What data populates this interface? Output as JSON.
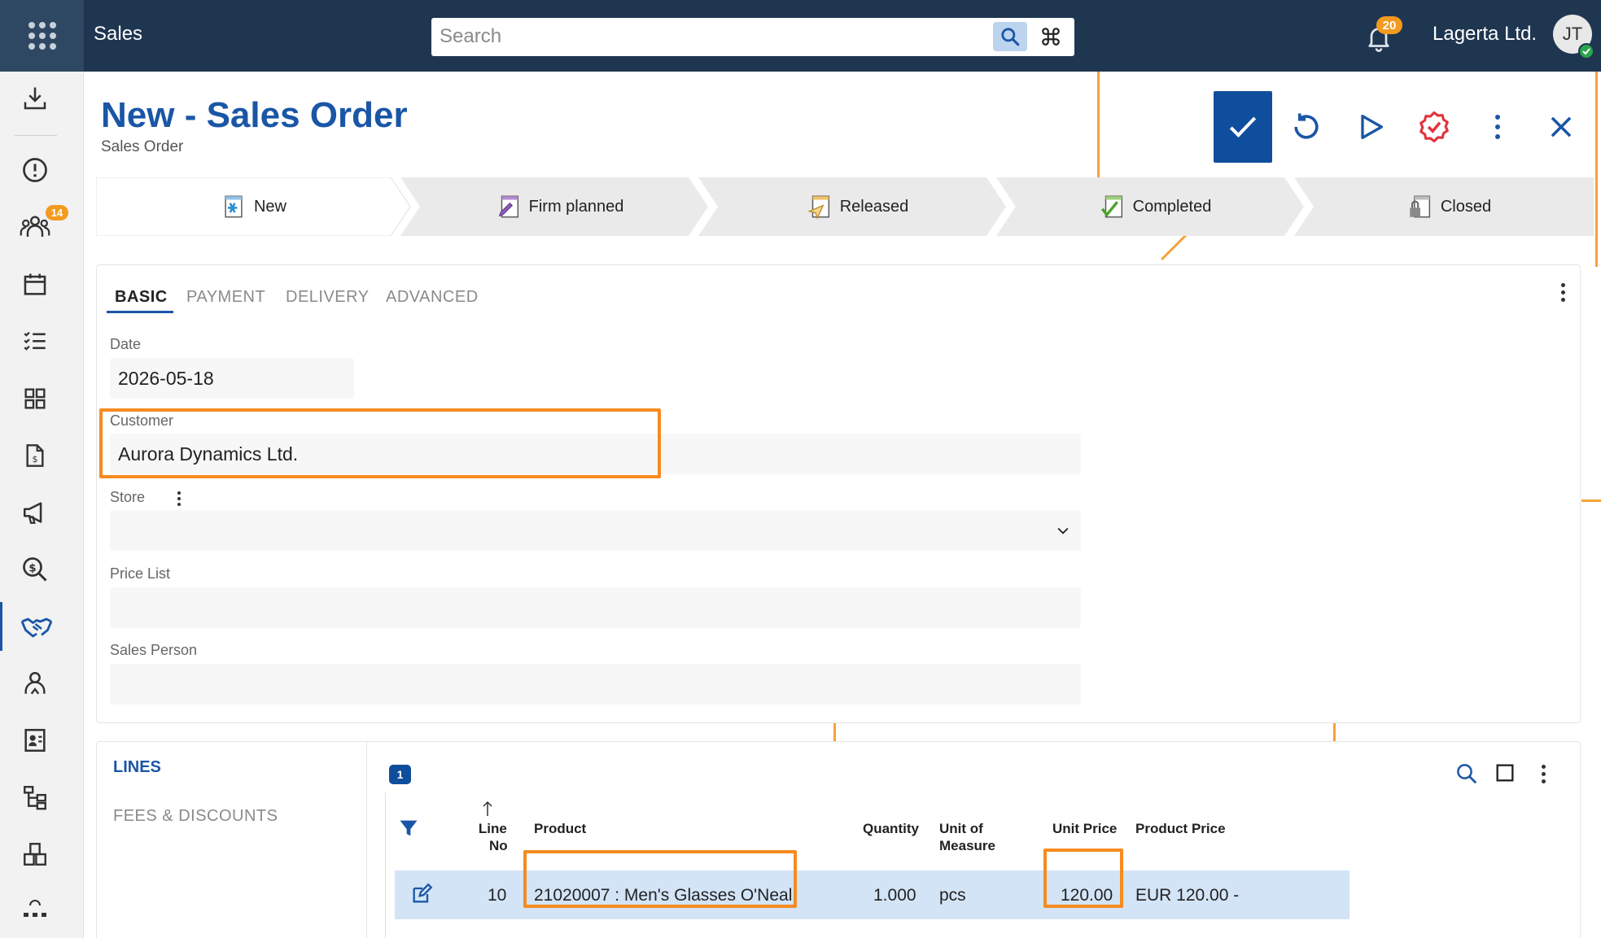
{
  "topbar": {
    "app_title": "Sales",
    "search_placeholder": "Search",
    "notification_count": "20",
    "company": "Lagerta Ltd.",
    "user_initials": "JT"
  },
  "sidebar": {
    "items": [
      {
        "icon": "download-tray-icon"
      },
      {
        "icon": "alert-circle-icon"
      },
      {
        "icon": "people-group-icon",
        "badge": "14"
      },
      {
        "icon": "calendar-icon"
      },
      {
        "icon": "checklist-icon"
      },
      {
        "icon": "dashboard-grid-icon"
      },
      {
        "icon": "document-icon"
      },
      {
        "icon": "megaphone-icon"
      },
      {
        "icon": "dollar-search-icon"
      },
      {
        "icon": "handshake-icon",
        "active": true
      },
      {
        "icon": "user-icon"
      },
      {
        "icon": "contact-card-icon"
      },
      {
        "icon": "hierarchy-icon"
      },
      {
        "icon": "boxes-icon"
      }
    ]
  },
  "page": {
    "title": "New - Sales Order",
    "subtitle": "Sales Order"
  },
  "status_steps": [
    "New",
    "Firm planned",
    "Released",
    "Completed",
    "Closed"
  ],
  "form": {
    "tabs": [
      "BASIC",
      "PAYMENT",
      "DELIVERY",
      "ADVANCED"
    ],
    "date_label": "Date",
    "date_value": "2026-05-18",
    "customer_label": "Customer",
    "customer_value": "Aurora Dynamics Ltd.",
    "store_label": "Store",
    "price_list_label": "Price List",
    "sales_person_label": "Sales Person"
  },
  "lines": {
    "nav_title": "LINES",
    "nav_sub": "FEES & DISCOUNTS",
    "count": "1",
    "columns": {
      "line_no_1": "Line",
      "line_no_2": "No",
      "product": "Product",
      "quantity": "Quantity",
      "uom_1": "Unit of",
      "uom_2": "Measure",
      "unit_price": "Unit Price",
      "product_price": "Product Price"
    },
    "rows": [
      {
        "line_no": "10",
        "product": "21020007 : Men's Glasses O'Neal",
        "quantity": "1.000",
        "uom": "pcs",
        "unit_price": "120.00",
        "product_price": "EUR 120.00 -"
      }
    ]
  },
  "colors": {
    "topbar": "#1f3651",
    "accent": "#1a56a6",
    "highlight": "#f68b1f",
    "badge": "#f39a1f"
  }
}
